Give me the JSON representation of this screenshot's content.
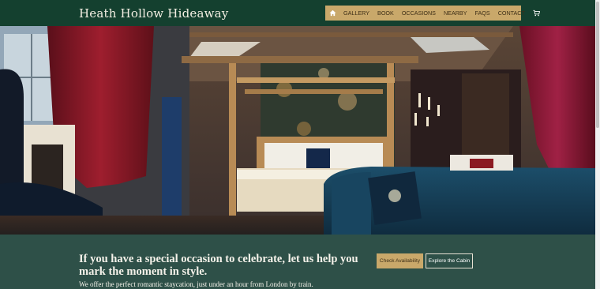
{
  "site": {
    "brand": "Heath Hollow Hideaway"
  },
  "nav": {
    "home_icon": "home-icon",
    "items": [
      "GALLERY",
      "BOOK",
      "OCCASIONS",
      "NEARBY",
      "FAQS",
      "CONTACT"
    ],
    "cart_icon": "cart-icon"
  },
  "band": {
    "heading": "If you have a special occasion to celebrate, let us help you mark the moment in style.",
    "subtext": "We offer the perfect romantic staycation, just under an hour from London by train.",
    "primary_button": "Check Availability",
    "secondary_button": "Explore the Cabin"
  },
  "colors": {
    "header_bg": "#14402f",
    "accent_gold": "#c9a86a",
    "band_bg": "#2e5048"
  }
}
